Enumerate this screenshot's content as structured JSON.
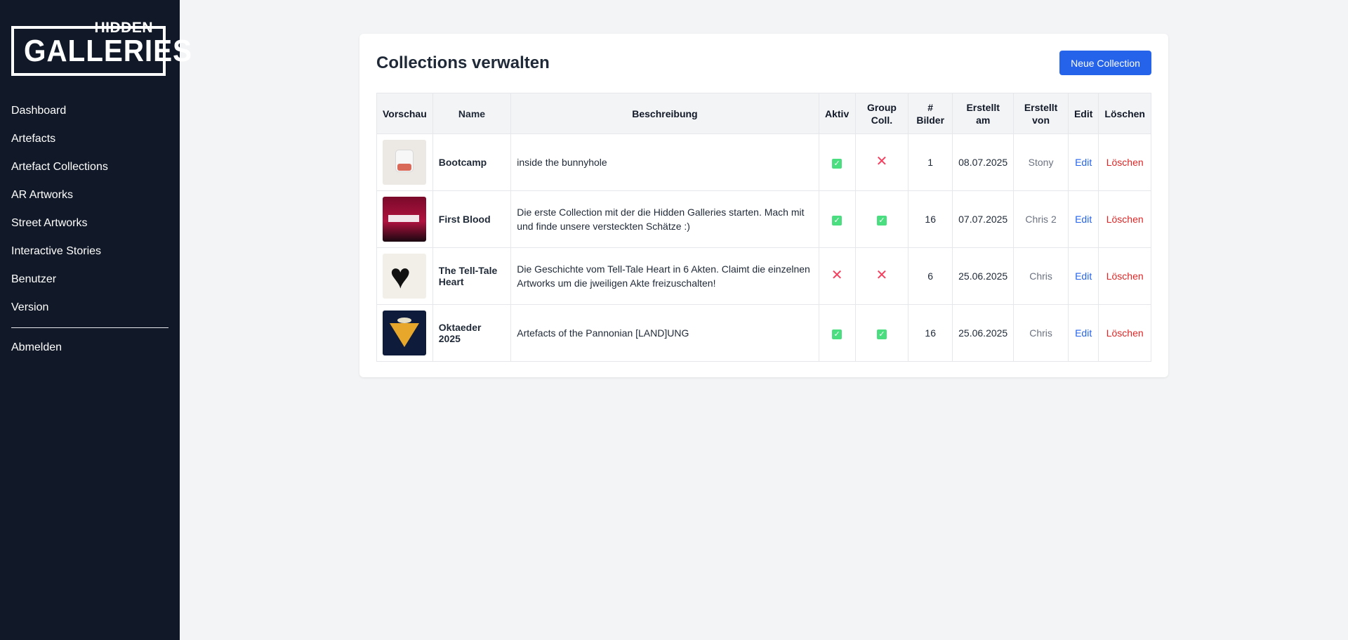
{
  "brand": {
    "line1": "HIDDEN",
    "line2": "GALLERIES"
  },
  "sidebar": {
    "items": [
      {
        "label": "Dashboard"
      },
      {
        "label": "Artefacts"
      },
      {
        "label": "Artefact Collections"
      },
      {
        "label": "AR Artworks"
      },
      {
        "label": "Street Artworks"
      },
      {
        "label": "Interactive Stories"
      },
      {
        "label": "Benutzer"
      },
      {
        "label": "Version"
      }
    ],
    "logout": "Abmelden"
  },
  "page": {
    "title": "Collections verwalten",
    "new_button": "Neue Collection"
  },
  "table": {
    "headers": {
      "preview": "Vorschau",
      "name": "Name",
      "description": "Beschreibung",
      "active": "Aktiv",
      "group": "Group Coll.",
      "images": "# Bilder",
      "created_at": "Erstellt am",
      "created_by": "Erstellt von",
      "edit": "Edit",
      "delete": "Löschen"
    },
    "rows": [
      {
        "name": "Bootcamp",
        "description": "inside the bunnyhole",
        "active": true,
        "group": false,
        "images": "1",
        "created_at": "08.07.2025",
        "created_by": "Stony",
        "edit": "Edit",
        "delete": "Löschen"
      },
      {
        "name": "First Blood",
        "description": "Die erste Collection mit der die Hidden Galleries starten. Mach mit und finde unsere versteckten Schätze :)",
        "active": true,
        "group": true,
        "images": "16",
        "created_at": "07.07.2025",
        "created_by": "Chris 2",
        "edit": "Edit",
        "delete": "Löschen"
      },
      {
        "name": "The Tell-Tale Heart",
        "description": "Die Geschichte vom Tell-Tale Heart in 6 Akten. Claimt die einzelnen Artworks um die jweiligen Akte freizuschalten!",
        "active": false,
        "group": false,
        "images": "6",
        "created_at": "25.06.2025",
        "created_by": "Chris",
        "edit": "Edit",
        "delete": "Löschen"
      },
      {
        "name": "Oktaeder 2025",
        "description": "Artefacts of the Pannonian [LAND]UNG",
        "active": true,
        "group": true,
        "images": "16",
        "created_at": "25.06.2025",
        "created_by": "Chris",
        "edit": "Edit",
        "delete": "Löschen"
      }
    ]
  },
  "colors": {
    "sidebar_bg": "#111827",
    "page_bg": "#f3f4f6",
    "primary": "#2563eb",
    "danger": "#dc2626",
    "check": "#4ade80",
    "cross": "#f43f5e"
  }
}
